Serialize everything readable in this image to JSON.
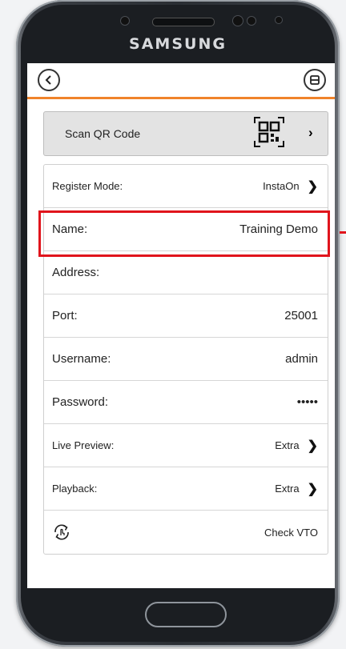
{
  "device": {
    "brand": "SAMSUNG"
  },
  "scan": {
    "label": "Scan QR Code"
  },
  "fields": [
    {
      "label": "Register Mode:",
      "value": "InstaOn",
      "chevron": true,
      "small": true
    },
    {
      "label": "Name:",
      "value": "Training Demo",
      "chevron": false,
      "small": false
    },
    {
      "label": "Address:",
      "value": "",
      "chevron": false,
      "small": false
    },
    {
      "label": "Port:",
      "value": "25001",
      "chevron": false,
      "small": false
    },
    {
      "label": "Username:",
      "value": "admin",
      "chevron": false,
      "small": false
    },
    {
      "label": "Password:",
      "value": "•••••",
      "chevron": false,
      "small": false
    },
    {
      "label": "Live Preview:",
      "value": "Extra",
      "chevron": true,
      "small": true
    },
    {
      "label": "Playback:",
      "value": "Extra",
      "chevron": true,
      "small": true
    }
  ],
  "check_vto": {
    "label": "Check VTO"
  },
  "colors": {
    "accent": "#f0832a",
    "highlight": "#e0141c"
  }
}
